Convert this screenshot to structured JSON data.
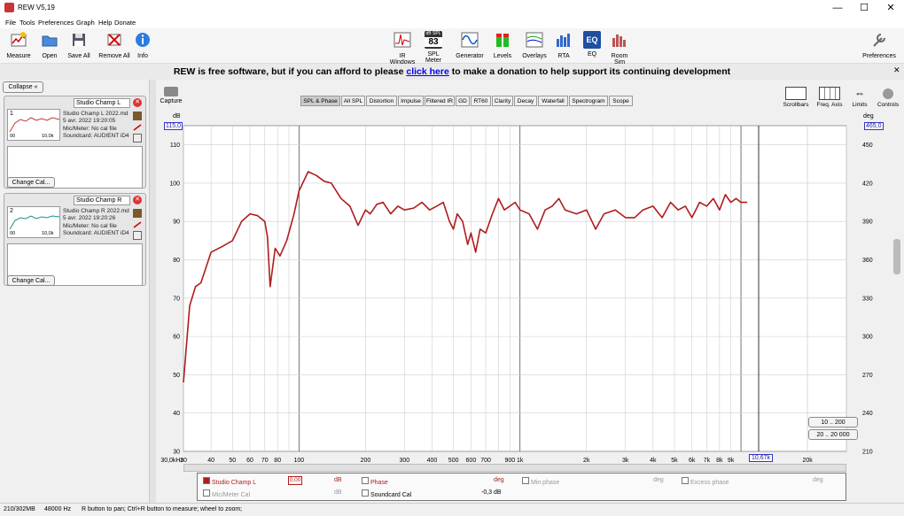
{
  "window": {
    "title": "REW V5,19",
    "minimize": "—",
    "maximize": "☐",
    "close": "✕"
  },
  "menu": [
    "File",
    "Tools",
    "Preferences",
    "Graph",
    "Help",
    "Donate"
  ],
  "toolbar": {
    "left": [
      "Measure",
      "Open",
      "Save All",
      "Remove All",
      "Info"
    ],
    "center": [
      "IR Windows",
      "SPL Meter",
      "Generator",
      "Levels",
      "Overlays",
      "RTA",
      "EQ",
      "Room Sim"
    ],
    "spl_meter_badge_top": "dB SPL",
    "spl_meter_value": "83",
    "right": "Preferences"
  },
  "banner": {
    "before": "REW is free software, but if you can afford to please",
    "link": "click here",
    "after": "to make a donation to help support its continuing development"
  },
  "left_panel": {
    "collapse": "Collapse",
    "measurements": [
      {
        "index": "1",
        "name": "Studio Champ L",
        "file": "Studio Champ L 2022.md",
        "date": "5 avr. 2022 19:20:05",
        "mic": "Mic/Meter: No cal file",
        "soundcard": "Soundcard: AUDIENT iD4",
        "thumb_left": "00",
        "thumb_right": "10,0k",
        "change_cal": "Change Cal...",
        "color": "#c0392b"
      },
      {
        "index": "2",
        "name": "Studio Champ R",
        "file": "Studio Champ R 2022.md",
        "date": "5 avr. 2022 19:20:26",
        "mic": "Mic/Meter: No cal file",
        "soundcard": "Soundcard: AUDIENT iD4",
        "thumb_left": "00",
        "thumb_right": "10,0k",
        "change_cal": "Change Cal...",
        "color": "#1a8f8f"
      }
    ]
  },
  "graph": {
    "capture": "Capture",
    "tabs": [
      "SPL & Phase",
      "All SPL",
      "Distortion",
      "Impulse",
      "Filtered IR",
      "GD",
      "RT60",
      "Clarity",
      "Decay",
      "Waterfall",
      "Spectrogram",
      "Scope"
    ],
    "active_tab": "SPL & Phase",
    "right_controls": [
      "Scrollbars",
      "Freq. Axis",
      "Limits",
      "Controls"
    ],
    "left_unit": "dB",
    "right_unit": "deg",
    "top_left_value": "115,0",
    "top_right_value": "465,0",
    "cursor_freq": "10,67k",
    "range_buttons": [
      "10 .. 200",
      "20 .. 20 000"
    ],
    "x_tick_labels": [
      "30",
      "40",
      "50",
      "60",
      "70",
      "80",
      "100",
      "200",
      "300",
      "400",
      "500",
      "600",
      "700",
      "900",
      "1k",
      "2k",
      "3k",
      "4k",
      "5k",
      "6k",
      "7k",
      "8k",
      "9k",
      "20k",
      "30,0kHz"
    ],
    "y_left_labels": [
      "110",
      "100",
      "90",
      "80",
      "70",
      "60",
      "50",
      "40",
      "30"
    ],
    "y_right_labels": [
      "450",
      "420",
      "390",
      "360",
      "330",
      "300",
      "270",
      "240",
      "210"
    ]
  },
  "chart_data": {
    "type": "line",
    "title": "",
    "xlabel": "",
    "ylabel": "dB",
    "x_scale": "log",
    "xlim": [
      30,
      30000
    ],
    "ylim": [
      30,
      115
    ],
    "y2lim": [
      210,
      465
    ],
    "series": [
      {
        "name": "Studio Champ L",
        "color": "#b01c1c",
        "x": [
          30,
          32,
          34,
          36,
          40,
          45,
          50,
          55,
          60,
          65,
          70,
          72,
          74,
          78,
          82,
          88,
          95,
          100,
          110,
          120,
          130,
          140,
          155,
          170,
          185,
          200,
          210,
          225,
          240,
          260,
          280,
          300,
          330,
          360,
          390,
          420,
          450,
          480,
          500,
          520,
          550,
          580,
          600,
          630,
          660,
          700,
          750,
          800,
          850,
          900,
          950,
          1000,
          1100,
          1200,
          1300,
          1400,
          1500,
          1600,
          1800,
          2000,
          2200,
          2400,
          2700,
          3000,
          3300,
          3600,
          4000,
          4400,
          4800,
          5200,
          5600,
          6000,
          6500,
          7000,
          7500,
          8000,
          8500,
          9000,
          9500,
          10000,
          10670
        ],
        "values": [
          48,
          68,
          73,
          74,
          82,
          83.5,
          85,
          90,
          92,
          91.5,
          90,
          86,
          73,
          83,
          81,
          85,
          92,
          98,
          103,
          102,
          100.5,
          100,
          96,
          94,
          89,
          93,
          92,
          94.5,
          95,
          92,
          94,
          93,
          93.5,
          95,
          93,
          94,
          95,
          90,
          88,
          92,
          90,
          84,
          87,
          82,
          88,
          87,
          92,
          96,
          93,
          94,
          95,
          93,
          92,
          88,
          93,
          94,
          96,
          93,
          92,
          93,
          88,
          92,
          93,
          91,
          91,
          93,
          94,
          91,
          95,
          93,
          94,
          91,
          95,
          94,
          96,
          93,
          97,
          95,
          96,
          95,
          95
        ]
      }
    ]
  },
  "legend": {
    "row1": {
      "name": "Studio Champ L",
      "offset": "0,00",
      "unit1": "dB",
      "phase": "Phase",
      "unit2": "deg",
      "minphase": "Min phase",
      "unit3": "deg",
      "excess": "Excess phase",
      "unit4": "deg"
    },
    "row2": {
      "name": "Mic/Meter Cal",
      "unit1": "dB",
      "soundcard": "Soundcard Cal",
      "sc_value": "-0,3 dB"
    }
  },
  "status": {
    "memory": "210/302MB",
    "rate": "48000 Hz",
    "hint": "R button to pan; Ctrl+R button to measure; wheel to zoom;"
  }
}
